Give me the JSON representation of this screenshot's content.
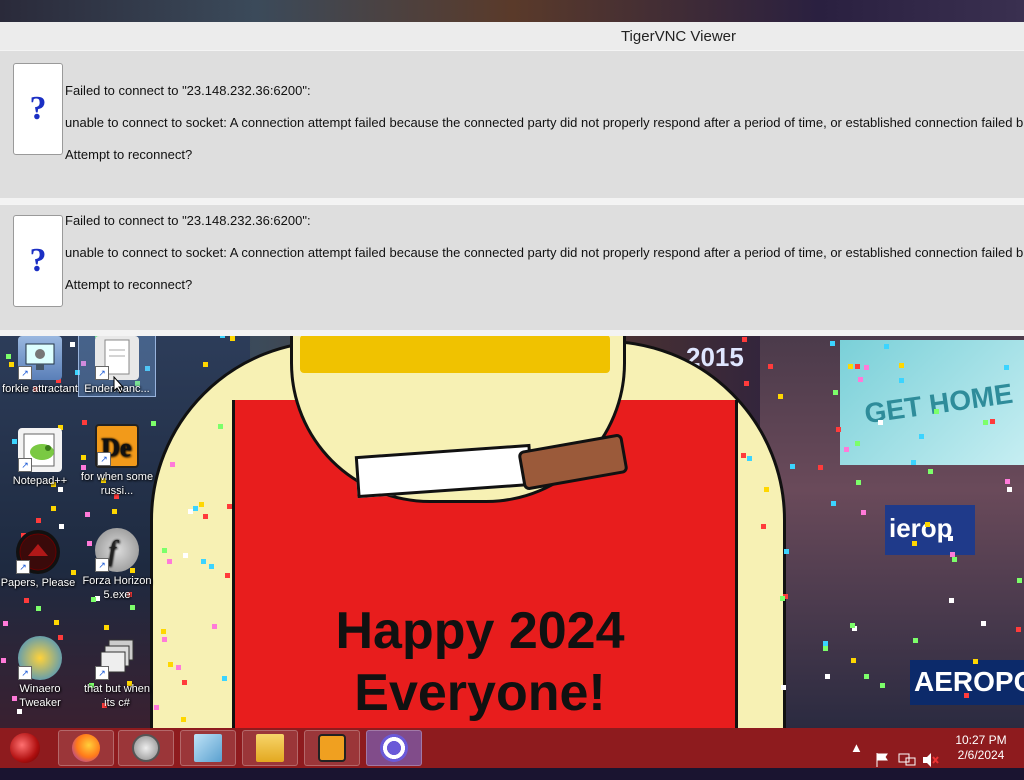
{
  "window": {
    "title": "TigerVNC Viewer"
  },
  "dialogs": [
    {
      "line1": "Failed to connect to \"23.148.232.36:6200\":",
      "line2": "unable to connect to socket: A connection attempt failed because the connected party did not properly respond after a period of time, or established connection failed b",
      "line3": "Attempt to reconnect?",
      "icon": "question-icon"
    },
    {
      "line1": "Failed to connect to \"23.148.232.36:6200\":",
      "line2": "unable to connect to socket: A connection attempt failed because the connected party did not properly respond after a period of time, or established connection failed b",
      "line3": "Attempt to reconnect?",
      "icon": "question-icon"
    }
  ],
  "desktop": {
    "icons": [
      {
        "label": "forkie attractant",
        "icon": "monitor-gear-icon"
      },
      {
        "label": "Endermanc...",
        "icon": "document-icon",
        "selected": true
      },
      {
        "label": "Notepad++",
        "icon": "notepad-icon"
      },
      {
        "label": "for when some russi...",
        "icon": "de-icon"
      },
      {
        "label": "Papers, Please",
        "icon": "papers-please-icon"
      },
      {
        "label": "Forza Horizon 5.exe",
        "icon": "flash-icon"
      },
      {
        "label": "Winaero Tweaker",
        "icon": "winaero-icon"
      },
      {
        "label": "that but when its c#",
        "icon": "windows-stack-icon"
      }
    ],
    "wallpaper_text": {
      "line1": "Happy 2024",
      "line2": "Everyone!",
      "year_sign": "2015",
      "screen_sign": "GET HOME",
      "sign_blue": "ierop",
      "sign_aero": "AEROPOS"
    }
  },
  "taskbar": {
    "apps": [
      {
        "name": "firefox-icon"
      },
      {
        "name": "safari-compass-icon"
      },
      {
        "name": "notebook-icon"
      },
      {
        "name": "file-explorer-icon"
      },
      {
        "name": "face-app-icon"
      },
      {
        "name": "settings-gear-icon"
      }
    ],
    "tray": {
      "chevron": "▲",
      "time": "10:27 PM",
      "date": "2/6/2024"
    }
  },
  "colors": {
    "taskbar": "#8e1b1e",
    "dialog_bg": "#dedede",
    "question_mark": "#1b2fc4"
  }
}
